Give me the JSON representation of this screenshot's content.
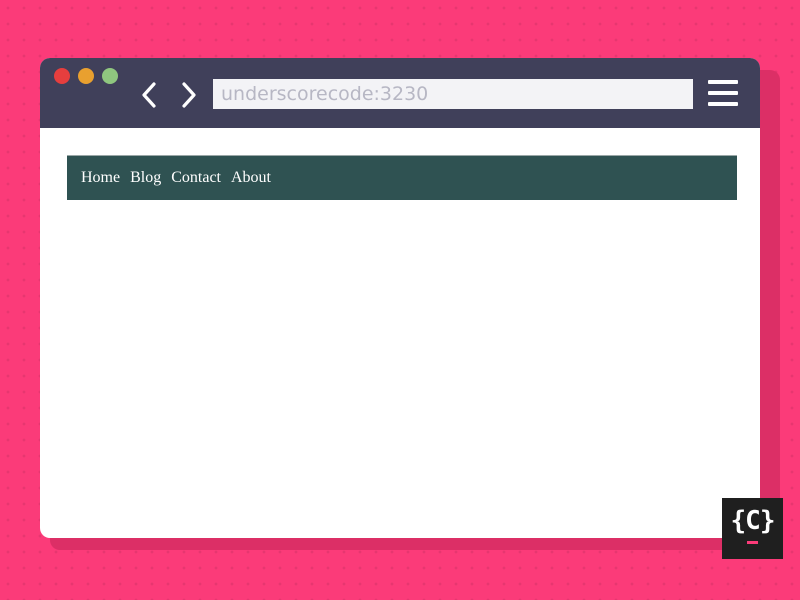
{
  "browser": {
    "window_controls": [
      "close",
      "minimize",
      "maximize"
    ],
    "address": "underscorecode:3230",
    "back_icon": "chevron-left-icon",
    "forward_icon": "chevron-right-icon",
    "menu_icon": "hamburger-menu-icon"
  },
  "site_nav": {
    "items": [
      {
        "label": "Home"
      },
      {
        "label": "Blog"
      },
      {
        "label": "Contact"
      },
      {
        "label": "About"
      }
    ]
  },
  "logo": {
    "text": "{C}"
  },
  "colors": {
    "background": "#fb3b79",
    "toolbar": "#40405a",
    "nav_bar": "#2f5252"
  }
}
